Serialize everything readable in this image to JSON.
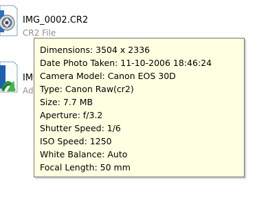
{
  "files": [
    {
      "name": "IMG_0002.CR2",
      "type": "CR2 File",
      "icon": "camera-raw-icon"
    },
    {
      "name": "IMG",
      "type": "Ad",
      "icon": "photoshop-raw-icon"
    }
  ],
  "tooltip": {
    "lines": [
      "Dimensions: 3504 x 2336",
      "Date Photo Taken: 11-10-2006 18:46:24",
      "Camera Model: Canon EOS 30D",
      "Type: Canon Raw(cr2)",
      "Size: 7.7 MB",
      "Aperture: f/3.2",
      "Shutter Speed: 1/6",
      "ISO Speed: 1250",
      "White Balance: Auto",
      "Focal Length: 50 mm"
    ],
    "background": "#ffffe1",
    "border": "#767676"
  }
}
